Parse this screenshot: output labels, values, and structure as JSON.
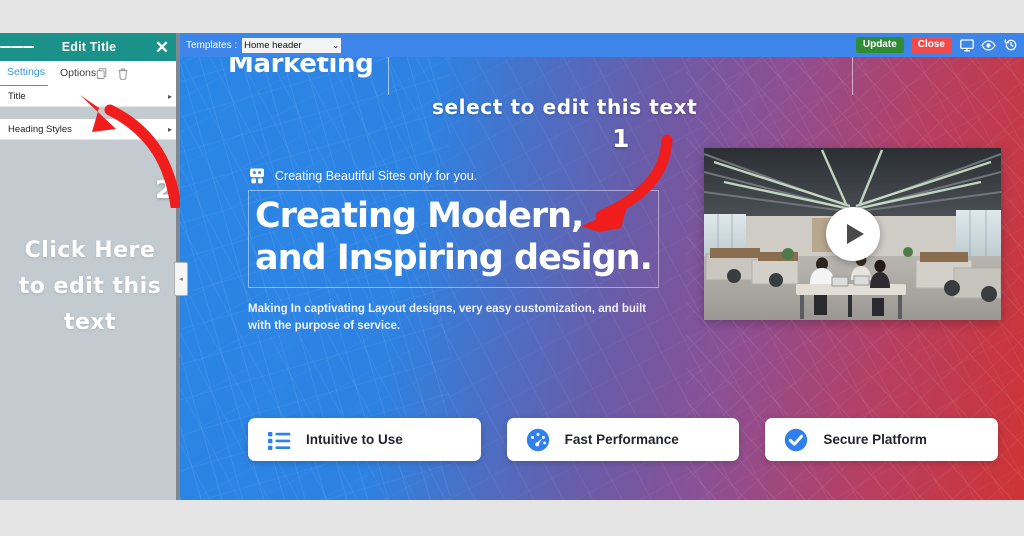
{
  "editor_panel": {
    "header": {
      "menu_icon": "hamburger-menu-icon",
      "title": "Edit Title",
      "close_icon": "close-icon"
    },
    "tabs": [
      {
        "label": "Settings",
        "active": true
      },
      {
        "label": "Options",
        "active": false
      }
    ],
    "tab_icons": [
      {
        "name": "duplicate-icon"
      },
      {
        "name": "trash-icon"
      }
    ],
    "rows": [
      {
        "label": "Title",
        "chevron": "▸"
      },
      {
        "label": "Heading Styles",
        "chevron": "▸"
      }
    ],
    "annotation": {
      "line1": "Click Here",
      "line2": "to edit this",
      "line3": "text",
      "badge": "2"
    }
  },
  "toolbar": {
    "templates_label": "Templates :",
    "template_selected": "Home header",
    "template_caret": "⌄",
    "update_label": "Update",
    "close_label": "Close",
    "icons": [
      {
        "name": "desktop-monitor-icon"
      },
      {
        "name": "preview-eye-icon"
      },
      {
        "name": "revision-history-icon"
      }
    ],
    "colors": {
      "bar": "#3d85e8",
      "update": "#2f8c35",
      "close": "#f04a4a"
    }
  },
  "canvas": {
    "site_logo": "Marketing",
    "hero": {
      "eyebrow_icon": "robot-avatar-icon",
      "eyebrow": "Creating Beautiful Sites only for you.",
      "heading_line1": "Creating Modern,",
      "heading_line2": "and Inspiring design.",
      "paragraph": "Making In captivating Layout designs, very easy customization, and built with the purpose of service."
    },
    "video": {
      "name": "office-workspace-photo",
      "play_icon": "play-button-icon"
    },
    "cards": [
      {
        "icon": "list-bullets-icon",
        "label": "Intuitive to Use"
      },
      {
        "icon": "speedometer-gauge-icon",
        "label": "Fast Performance"
      },
      {
        "icon": "check-circle-icon",
        "label": "Secure Platform"
      }
    ],
    "annotation": {
      "text": "select to edit this text",
      "badge": "1"
    },
    "gradient": {
      "start": "#2a86e6",
      "mid": "#6a5ca8",
      "end": "#cf3434"
    }
  },
  "collapse_handle": {
    "icon": "chevron-left-icon",
    "glyph": "◂"
  }
}
